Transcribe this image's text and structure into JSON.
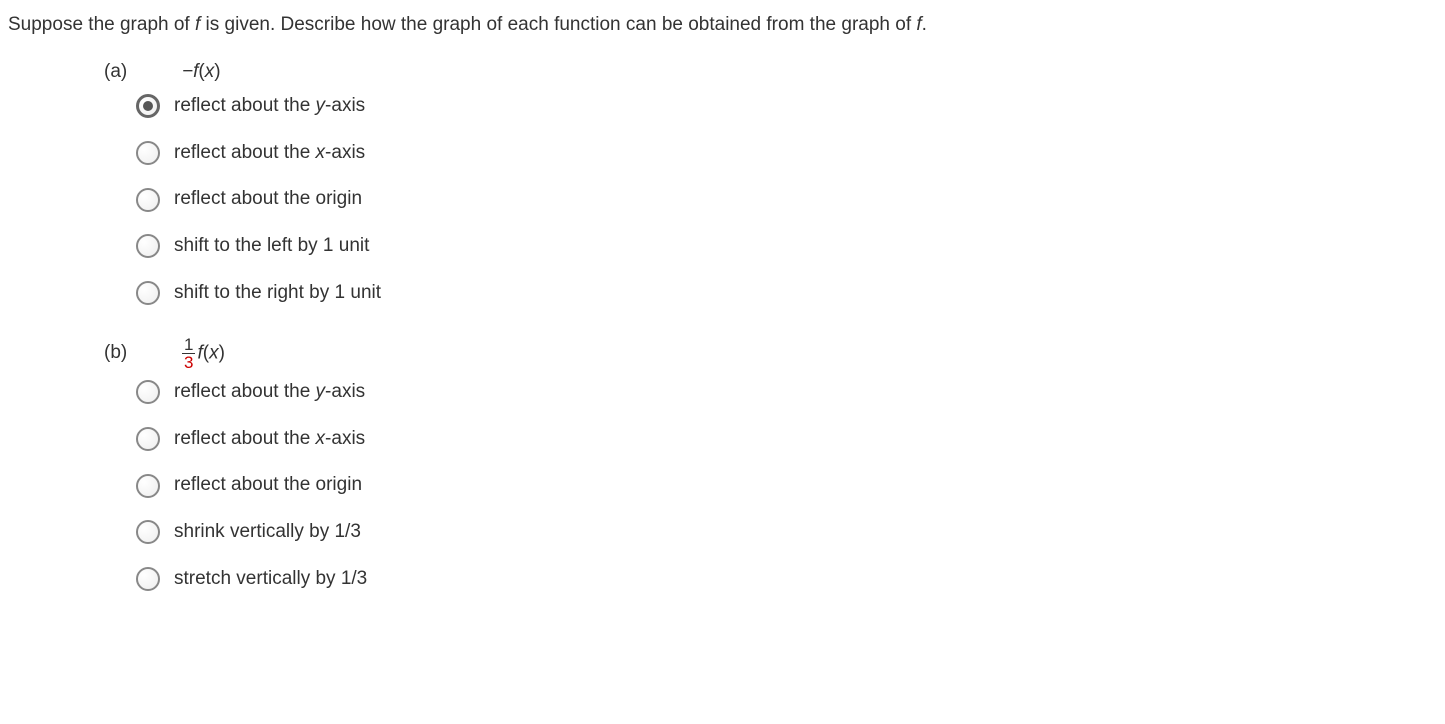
{
  "intro_pre": "Suppose the graph of ",
  "intro_f1": "f",
  "intro_mid": " is given. Describe how the graph of each function can be obtained from the graph of ",
  "intro_f2": "f",
  "intro_post": ".",
  "partA": {
    "label": "(a)",
    "expr_pre": "−",
    "expr_f": "f",
    "expr_post": "(",
    "expr_x": "x",
    "expr_close": ")",
    "opts": [
      {
        "pre": "reflect about the ",
        "var": "y",
        "post": "-axis",
        "sel": true
      },
      {
        "pre": "reflect about the ",
        "var": "x",
        "post": "-axis",
        "sel": false
      },
      {
        "pre": "reflect about the origin",
        "var": "",
        "post": "",
        "sel": false
      },
      {
        "pre": "shift to the left by 1 unit",
        "var": "",
        "post": "",
        "sel": false
      },
      {
        "pre": "shift to the right by 1 unit",
        "var": "",
        "post": "",
        "sel": false
      }
    ]
  },
  "partB": {
    "label": "(b)",
    "frac_num": "1",
    "frac_den": "3",
    "expr_f": "f",
    "expr_post": "(",
    "expr_x": "x",
    "expr_close": ")",
    "opts": [
      {
        "pre": "reflect about the ",
        "var": "y",
        "post": "-axis",
        "sel": false
      },
      {
        "pre": "reflect about the ",
        "var": "x",
        "post": "-axis",
        "sel": false
      },
      {
        "pre": "reflect about the origin",
        "var": "",
        "post": "",
        "sel": false
      },
      {
        "pre": "shrink vertically by 1/3",
        "var": "",
        "post": "",
        "sel": false
      },
      {
        "pre": "stretch vertically by 1/3",
        "var": "",
        "post": "",
        "sel": false
      }
    ]
  }
}
